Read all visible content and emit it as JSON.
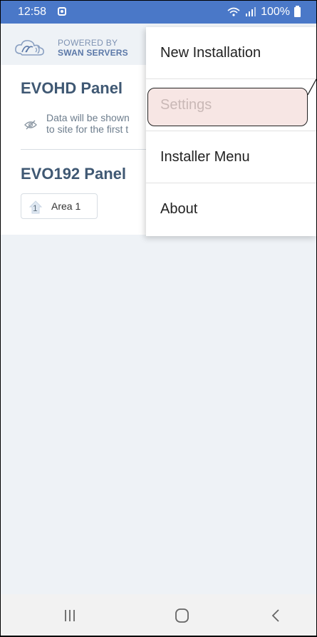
{
  "status_bar": {
    "time": "12:58",
    "battery": "100%"
  },
  "header": {
    "logo_line1": "POWERED BY",
    "logo_line2": "SWAN SERVERS"
  },
  "panels": [
    {
      "title": "EVOHD Panel",
      "info_line1": "Data will be shown",
      "info_line2": "to site for the first t"
    },
    {
      "title": "EVO192 Panel",
      "areas": [
        {
          "number": "1",
          "label": "Area 1"
        }
      ]
    }
  ],
  "menu": {
    "items": [
      {
        "label": "New Installation"
      },
      {
        "label": "Settings"
      },
      {
        "label": "Installer Menu"
      },
      {
        "label": "About"
      }
    ]
  },
  "colors": {
    "status_bar": "#4a78c8",
    "background": "#eef2f6",
    "panel_title": "#3f5873",
    "highlight": "#f0d2cd"
  }
}
